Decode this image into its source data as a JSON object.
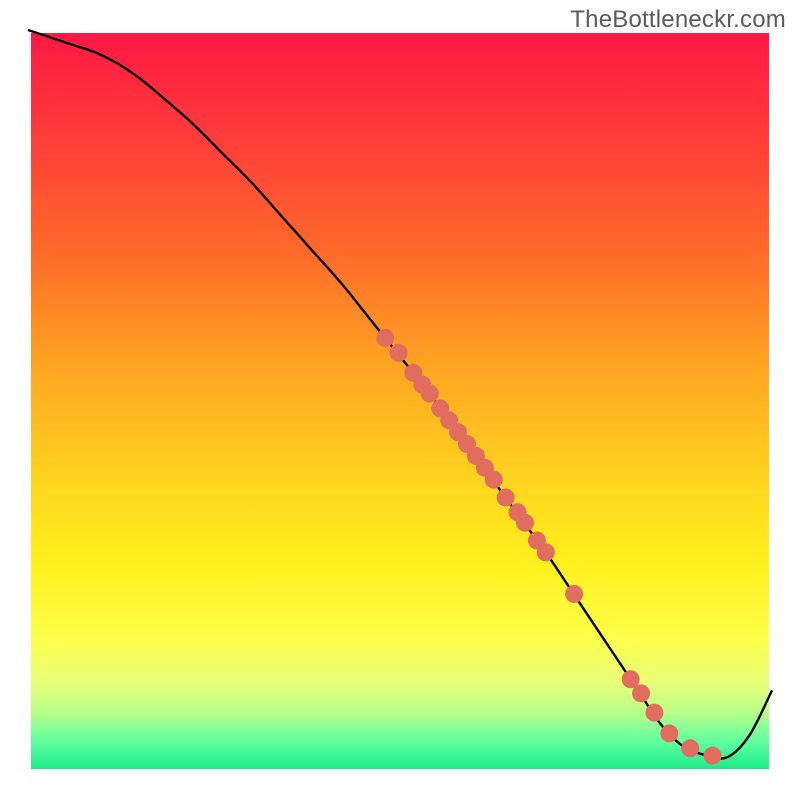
{
  "watermark": "TheBottleneckr.com",
  "chart_data": {
    "type": "line",
    "title": "",
    "xlabel": "",
    "ylabel": "",
    "xlim": [
      0,
      100
    ],
    "ylim": [
      0,
      100
    ],
    "background_gradient": {
      "colors": [
        {
          "offset": 0.0,
          "color": "#ff1744"
        },
        {
          "offset": 0.14,
          "color": "#ff3b3b"
        },
        {
          "offset": 0.3,
          "color": "#ff6a2a"
        },
        {
          "offset": 0.45,
          "color": "#ffa322"
        },
        {
          "offset": 0.6,
          "color": "#ffd21f"
        },
        {
          "offset": 0.72,
          "color": "#fff01e"
        },
        {
          "offset": 0.82,
          "color": "#fdff4a"
        },
        {
          "offset": 0.88,
          "color": "#e8ff7a"
        },
        {
          "offset": 0.92,
          "color": "#b8ff8a"
        },
        {
          "offset": 0.96,
          "color": "#5effa0"
        },
        {
          "offset": 1.0,
          "color": "#17e884"
        }
      ]
    },
    "series": [
      {
        "name": "bottleneck-curve",
        "x": [
          0,
          3,
          6,
          9,
          12,
          15,
          18,
          22,
          26,
          30,
          34,
          38,
          42,
          46,
          50,
          54,
          58,
          62,
          66,
          70,
          74,
          78,
          82,
          85,
          88,
          91,
          94,
          97,
          100
        ],
        "y": [
          100,
          99,
          98,
          97,
          95.5,
          93.5,
          91,
          87.5,
          83.5,
          79.5,
          75,
          70.5,
          66,
          61,
          56,
          51,
          45.5,
          40,
          34.5,
          29,
          23,
          17,
          11,
          6.5,
          3.5,
          2.3,
          2.0,
          5,
          11
        ],
        "color": "#000000",
        "linewidth": 2.4
      }
    ],
    "scatter_points": {
      "name": "data-markers",
      "color": "#e06d5e",
      "radius": 9,
      "points": [
        {
          "x": 48.0,
          "y": 58.5
        },
        {
          "x": 49.8,
          "y": 56.5
        },
        {
          "x": 51.8,
          "y": 53.8
        },
        {
          "x": 53.0,
          "y": 52.2
        },
        {
          "x": 54.0,
          "y": 51.0
        },
        {
          "x": 55.4,
          "y": 49.0
        },
        {
          "x": 56.6,
          "y": 47.4
        },
        {
          "x": 57.8,
          "y": 45.8
        },
        {
          "x": 59.0,
          "y": 44.2
        },
        {
          "x": 60.2,
          "y": 42.6
        },
        {
          "x": 61.4,
          "y": 41.0
        },
        {
          "x": 62.6,
          "y": 39.4
        },
        {
          "x": 64.2,
          "y": 37.0
        },
        {
          "x": 65.8,
          "y": 35.0
        },
        {
          "x": 66.8,
          "y": 33.6
        },
        {
          "x": 68.4,
          "y": 31.2
        },
        {
          "x": 69.6,
          "y": 29.6
        },
        {
          "x": 73.4,
          "y": 24.0
        },
        {
          "x": 81.0,
          "y": 12.5
        },
        {
          "x": 82.4,
          "y": 10.6
        },
        {
          "x": 84.2,
          "y": 8.0
        },
        {
          "x": 86.2,
          "y": 5.2
        },
        {
          "x": 89.0,
          "y": 3.2
        },
        {
          "x": 92.0,
          "y": 2.2
        }
      ]
    }
  }
}
